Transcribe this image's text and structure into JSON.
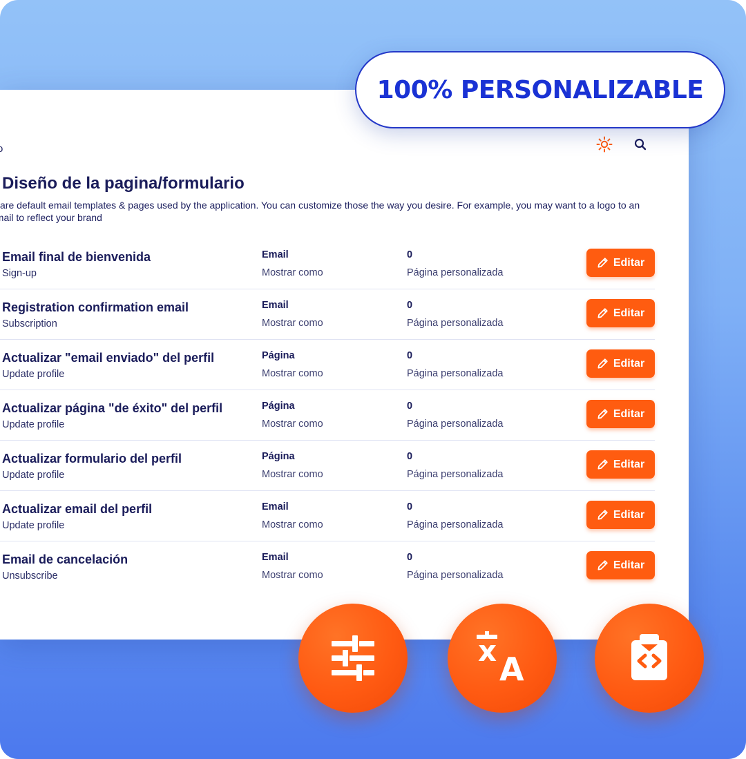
{
  "badge": {
    "text": "100% PERSONALIZABLE"
  },
  "header": {
    "crumb": "o"
  },
  "page": {
    "title": "Diseño de la pagina/formulario",
    "description": "w are default email templates & pages used by the application. You can customize those the way you desire. For example, you may want to a logo to an email to reflect your brand"
  },
  "rows": [
    {
      "name": "Email final de bienvenida",
      "category": "Sign-up",
      "type": "Email",
      "show_as": "Mostrar como",
      "count": "0",
      "custom": "Página personalizada",
      "edit": "Editar"
    },
    {
      "name": "Registration confirmation email",
      "category": "Subscription",
      "type": "Email",
      "show_as": "Mostrar como",
      "count": "0",
      "custom": "Página personalizada",
      "edit": "Editar"
    },
    {
      "name": "Actualizar \"email enviado\" del perfil",
      "category": "Update profile",
      "type": "Página",
      "show_as": "Mostrar como",
      "count": "0",
      "custom": "Página personalizada",
      "edit": "Editar"
    },
    {
      "name": "Actualizar página \"de éxito\" del perfil",
      "category": "Update profile",
      "type": "Página",
      "show_as": "Mostrar como",
      "count": "0",
      "custom": "Página personalizada",
      "edit": "Editar"
    },
    {
      "name": "Actualizar formulario del perfil",
      "category": "Update profile",
      "type": "Página",
      "show_as": "Mostrar como",
      "count": "0",
      "custom": "Página personalizada",
      "edit": "Editar"
    },
    {
      "name": "Actualizar email del perfil",
      "category": "Update profile",
      "type": "Email",
      "show_as": "Mostrar como",
      "count": "0",
      "custom": "Página personalizada",
      "edit": "Editar"
    },
    {
      "name": "Email de cancelación",
      "category": "Unsubscribe",
      "type": "Email",
      "show_as": "Mostrar como",
      "count": "0",
      "custom": "Página personalizada",
      "edit": "Editar"
    }
  ],
  "feature_icons": [
    "sliders-icon",
    "translate-icon",
    "code-clipboard-icon"
  ],
  "icons": {
    "theme": "sun-icon",
    "search": "search-icon",
    "edit": "pencil-icon"
  },
  "colors": {
    "accent": "#ff5c10",
    "title": "#1a1c5a",
    "badge_text": "#1a32d4",
    "background_top": "#93c2f8",
    "background_bottom": "#4c79ee"
  }
}
